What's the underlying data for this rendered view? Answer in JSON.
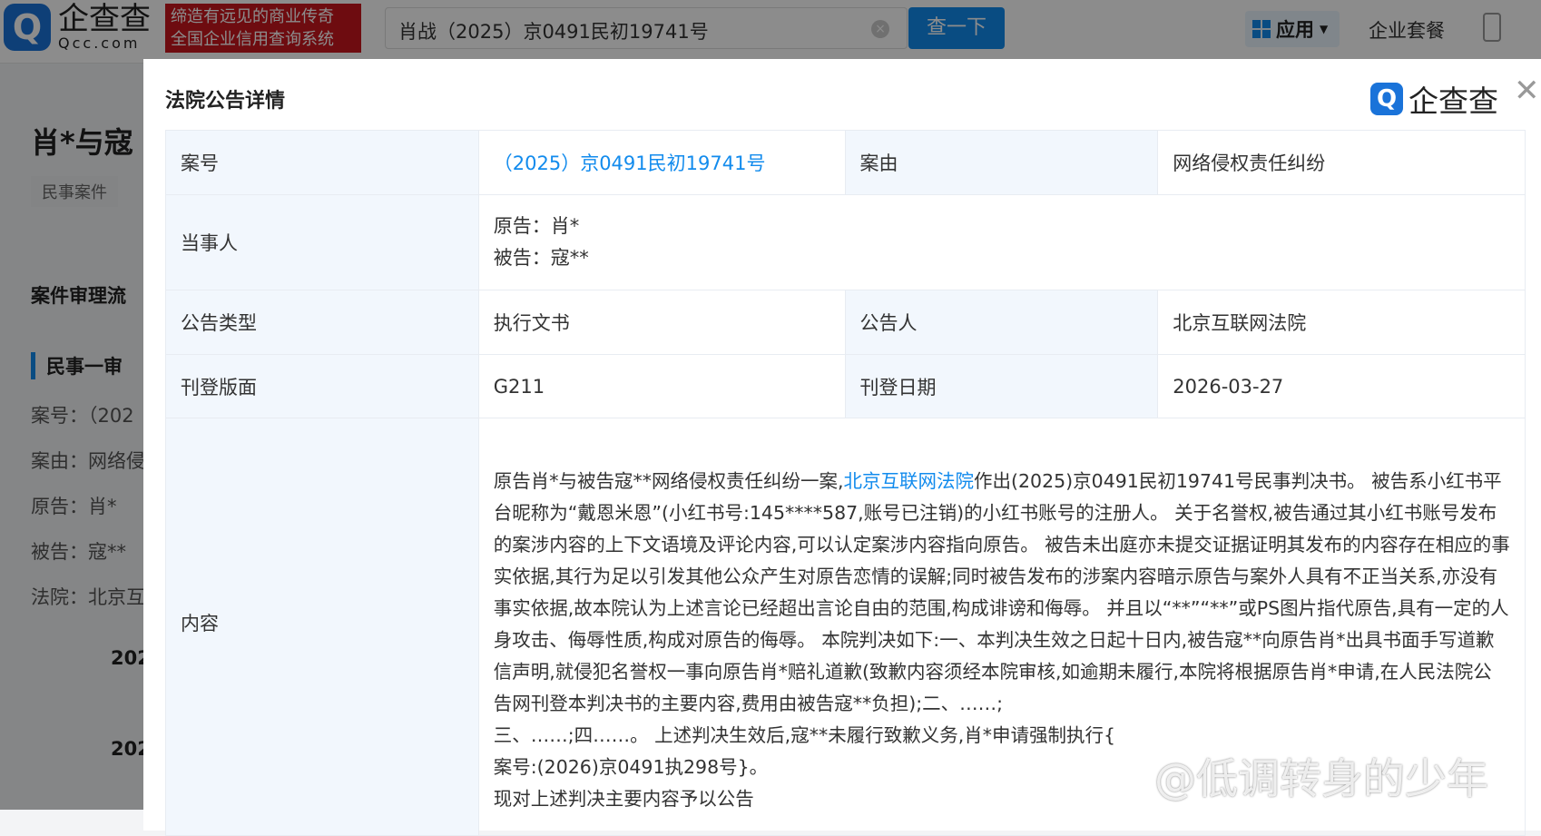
{
  "header": {
    "logo_cn": "企查查",
    "logo_en": "Qcc.com",
    "slogan_line1": "缔造有远见的商业传奇",
    "slogan_line2": "全国企业信用查询系统",
    "search_value": "肖战（2025）京0491民初19741号",
    "search_button": "查一下",
    "apps_label": "应用",
    "package_label": "企业套餐"
  },
  "background_page": {
    "title": "肖*与寇",
    "tag": "民事案件",
    "section": "案件审理流",
    "stage": "民事一审",
    "case_no": "案号：（202",
    "cause": "案由：网络侵",
    "plaintiff": "原告：肖*",
    "defendant": "被告：寇**",
    "court": "法院：北京互",
    "year1": "202",
    "year2": "202"
  },
  "modal": {
    "title": "法院公告详情",
    "brand": "企查查",
    "rows": {
      "case_no_label": "案号",
      "case_no": "（2025）京0491民初19741号",
      "cause_label": "案由",
      "cause": "网络侵权责任纠纷",
      "parties_label": "当事人",
      "plaintiff": "原告：肖*",
      "defendant": "被告：寇**",
      "type_label": "公告类型",
      "type": "执行文书",
      "announcer_label": "公告人",
      "announcer": "北京互联网法院",
      "page_label": "刊登版面",
      "page": "G211",
      "date_label": "刊登日期",
      "date": "2026-03-27",
      "content_label": "内容",
      "content_pre": "原告肖*与被告寇**网络侵权责任纠纷一案,",
      "content_link": "北京互联网法院",
      "content_post": "作出(2025)京0491民初19741号民事判决书。 被告系小红书平台昵称为“戴恩米恩”(小红书号:145****587,账号已注销)的小红书账号的注册人。 关于名誉权,被告通过其小红书账号发布的案涉内容的上下文语境及评论内容,可以认定案涉内容指向原告。 被告未出庭亦未提交证据证明其发布的内容存在相应的事实依据,其行为足以引发其他公众产生对原告恋情的误解;同时被告发布的涉案内容暗示原告与案外人具有不正当关系,亦没有事实依据,故本院认为上述言论已经超出言论自由的范围,构成诽谤和侮辱。 并且以“**”“**”或PS图片指代原告,具有一定的人身攻击、侮辱性质,构成对原告的侮辱。 本院判决如下:一、本判决生效之日起十日内,被告寇**向原告肖*出具书面手写道歉信声明,就侵犯名誉权一事向原告肖*赔礼道歉(致歉内容须经本院审核,如逾期未履行,本院将根据原告肖*申请,在人民法院公告网刊登本判决书的主要内容,费用由被告寇**负担);二、……;",
      "content_line2": "三、……;四……。 上述判决生效后,寇**未履行致歉义务,肖*申请强制执行{",
      "content_line3": "案号:(2026)京0491执298号}。",
      "content_line4": "现对上述判决主要内容予以公告"
    }
  },
  "watermark": "@低调转身的少年"
}
